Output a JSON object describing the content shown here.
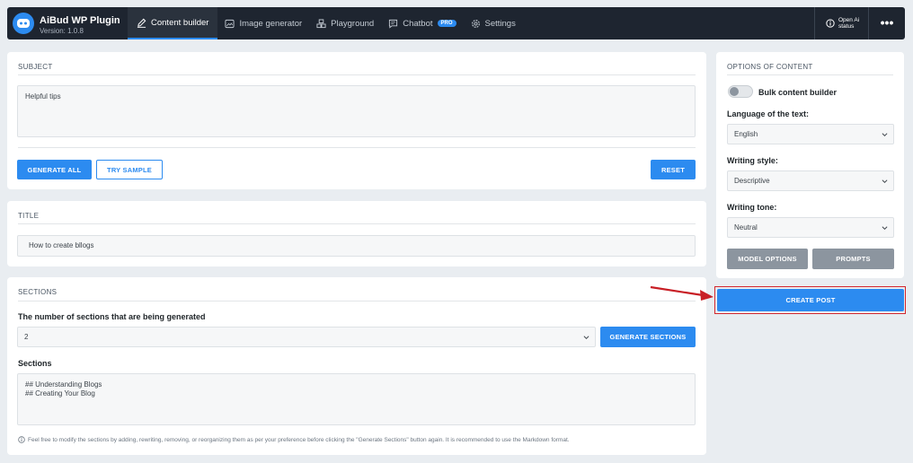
{
  "header": {
    "app_name": "AiBud WP Plugin",
    "version": "Version: 1.0.8",
    "tabs": [
      {
        "label": "Content builder",
        "active": true
      },
      {
        "label": "Image generator"
      },
      {
        "label": "Playground"
      },
      {
        "label": "Chatbot",
        "badge": "PRO"
      },
      {
        "label": "Settings"
      }
    ],
    "openai_status": "Open Ai status",
    "more_label": "•••"
  },
  "subject": {
    "heading": "SUBJECT",
    "value": "Helpful tips",
    "generate_all": "GENERATE ALL",
    "try_sample": "TRY SAMPLE",
    "reset": "RESET"
  },
  "title": {
    "heading": "TITLE",
    "value": "How to create bllogs"
  },
  "sections": {
    "heading": "SECTIONS",
    "count_label": "The number of sections that are being generated",
    "count_value": "2",
    "generate_sections": "GENERATE SECTIONS",
    "sections_label": "Sections",
    "sections_value": "## Understanding Blogs\n## Creating Your Blog",
    "hint": "Feel free to modify the sections by adding, rewriting, removing, or reorganizing them as per your preference before clicking the \"Generate Sections\" button again. It is recommended to use the Markdown format."
  },
  "options": {
    "heading": "OPTIONS OF CONTENT",
    "bulk_label": "Bulk content builder",
    "bulk_enabled": false,
    "language_label": "Language of the text:",
    "language_value": "English",
    "style_label": "Writing style:",
    "style_value": "Descriptive",
    "tone_label": "Writing tone:",
    "tone_value": "Neutral",
    "model_options": "MODEL OPTIONS",
    "prompts": "PROMPTS"
  },
  "create_post": "CREATE POST",
  "colors": {
    "accent": "#2c8bf0",
    "topbar": "#1e2530",
    "highlight": "#d3262e"
  }
}
